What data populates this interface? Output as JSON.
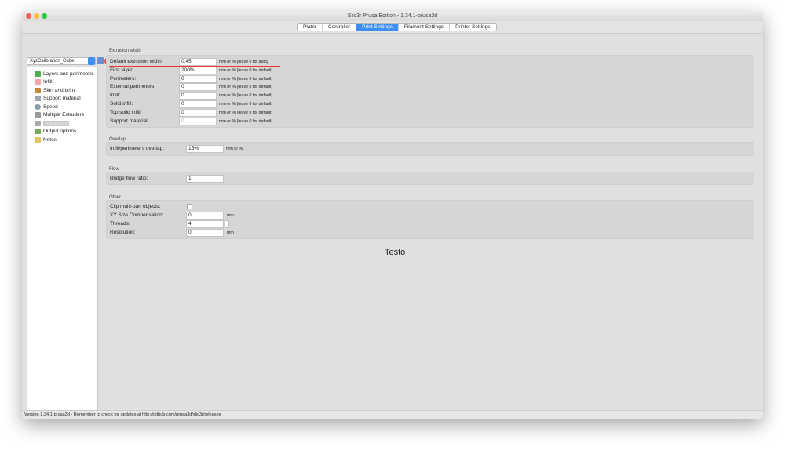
{
  "window": {
    "title": "Slic3r Prusa Edition - 1.34.1-prusa3d"
  },
  "tabs": [
    {
      "label": "Plater"
    },
    {
      "label": "Controller"
    },
    {
      "label": "Print Settings",
      "active": true
    },
    {
      "label": "Filament Settings"
    },
    {
      "label": "Printer Settings"
    }
  ],
  "preset": {
    "value": "XyzCalibration_Cube"
  },
  "sidebar": {
    "items": [
      {
        "label": "Layers and perimeters",
        "color": "#4caf50"
      },
      {
        "label": "Infill",
        "color": "#e57373"
      },
      {
        "label": "Skirt and brim",
        "color": "#c8883a"
      },
      {
        "label": "Support material",
        "color": "#9aa5b5"
      },
      {
        "label": "Speed",
        "color": "#8899aa"
      },
      {
        "label": "Multiple Extruders",
        "color": "#999999"
      },
      {
        "label": "Advanced",
        "color": "#aaaaaa",
        "selected": true
      },
      {
        "label": "Output options",
        "color": "#77aa55"
      },
      {
        "label": "Notes",
        "color": "#e8c060"
      }
    ]
  },
  "sections": {
    "extrusion": {
      "title": "Extrusion width",
      "rows": [
        {
          "label": "Default extrusion width:",
          "value": "0.45",
          "unit": "mm or % (leave 0 for auto)"
        },
        {
          "label": "First layer:",
          "value": "200%",
          "unit": "mm or % (leave 0 for default)"
        },
        {
          "label": "Perimeters:",
          "value": "0",
          "unit": "mm or % (leave 0 for default)"
        },
        {
          "label": "External perimeters:",
          "value": "0",
          "unit": "mm or % (leave 0 for default)"
        },
        {
          "label": "Infill:",
          "value": "0",
          "unit": "mm or % (leave 0 for default)"
        },
        {
          "label": "Solid infill:",
          "value": "0",
          "unit": "mm or % (leave 0 for default)"
        },
        {
          "label": "Top solid infill:",
          "value": "0",
          "unit": "mm or % (leave 0 for default)"
        },
        {
          "label": "Support material:",
          "value": "0",
          "unit": "mm or % (leave 0 for default)"
        }
      ]
    },
    "overlap": {
      "title": "Overlap",
      "label": "Infill/perimeters overlap:",
      "value": "15%",
      "unit": "mm or %"
    },
    "flow": {
      "title": "Flow",
      "label": "Bridge flow ratio:",
      "value": "1"
    },
    "other": {
      "title": "Other",
      "clip_label": "Clip multi-part objects:",
      "xy_label": "XY Size Compensation:",
      "xy_value": "0",
      "xy_unit": "mm",
      "threads_label": "Threads:",
      "threads_value": "4",
      "res_label": "Resolution:",
      "res_value": "0",
      "res_unit": "mm"
    }
  },
  "overlay_text": "Testo",
  "status": "Version 1.34.1-prusa3d - Remember to check for updates at http://github.com/prusa3d/slic3r/releases",
  "accent": "#e53935"
}
